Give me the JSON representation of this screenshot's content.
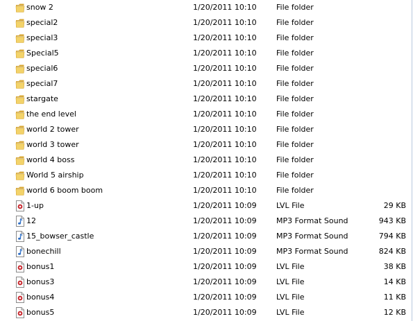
{
  "files": [
    {
      "name": "snow 2",
      "date": "1/20/2011 10:10",
      "type": "File folder",
      "size": "",
      "icon": "folder-icon"
    },
    {
      "name": "special2",
      "date": "1/20/2011 10:10",
      "type": "File folder",
      "size": "",
      "icon": "folder-icon"
    },
    {
      "name": "special3",
      "date": "1/20/2011 10:10",
      "type": "File folder",
      "size": "",
      "icon": "folder-icon"
    },
    {
      "name": "Special5",
      "date": "1/20/2011 10:10",
      "type": "File folder",
      "size": "",
      "icon": "folder-icon"
    },
    {
      "name": "special6",
      "date": "1/20/2011 10:10",
      "type": "File folder",
      "size": "",
      "icon": "folder-icon"
    },
    {
      "name": "special7",
      "date": "1/20/2011 10:10",
      "type": "File folder",
      "size": "",
      "icon": "folder-icon"
    },
    {
      "name": "stargate",
      "date": "1/20/2011 10:10",
      "type": "File folder",
      "size": "",
      "icon": "folder-icon"
    },
    {
      "name": "the end level",
      "date": "1/20/2011 10:10",
      "type": "File folder",
      "size": "",
      "icon": "folder-icon"
    },
    {
      "name": "world 2 tower",
      "date": "1/20/2011 10:10",
      "type": "File folder",
      "size": "",
      "icon": "folder-icon"
    },
    {
      "name": "world 3 tower",
      "date": "1/20/2011 10:10",
      "type": "File folder",
      "size": "",
      "icon": "folder-icon"
    },
    {
      "name": "world 4 boss",
      "date": "1/20/2011 10:10",
      "type": "File folder",
      "size": "",
      "icon": "folder-icon"
    },
    {
      "name": "World 5 airship",
      "date": "1/20/2011 10:10",
      "type": "File folder",
      "size": "",
      "icon": "folder-icon"
    },
    {
      "name": "world 6 boom boom",
      "date": "1/20/2011 10:10",
      "type": "File folder",
      "size": "",
      "icon": "folder-icon"
    },
    {
      "name": "1-up",
      "date": "1/20/2011 10:09",
      "type": "LVL File",
      "size": "29 KB",
      "icon": "lvl-file-icon"
    },
    {
      "name": "12",
      "date": "1/20/2011 10:09",
      "type": "MP3 Format Sound",
      "size": "943 KB",
      "icon": "mp3-file-icon"
    },
    {
      "name": "15_bowser_castle",
      "date": "1/20/2011 10:09",
      "type": "MP3 Format Sound",
      "size": "794 KB",
      "icon": "mp3-file-icon"
    },
    {
      "name": "bonechill",
      "date": "1/20/2011 10:09",
      "type": "MP3 Format Sound",
      "size": "824 KB",
      "icon": "mp3-file-icon"
    },
    {
      "name": "bonus1",
      "date": "1/20/2011 10:09",
      "type": "LVL File",
      "size": "38 KB",
      "icon": "lvl-file-icon"
    },
    {
      "name": "bonus3",
      "date": "1/20/2011 10:09",
      "type": "LVL File",
      "size": "14 KB",
      "icon": "lvl-file-icon"
    },
    {
      "name": "bonus4",
      "date": "1/20/2011 10:09",
      "type": "LVL File",
      "size": "11 KB",
      "icon": "lvl-file-icon"
    },
    {
      "name": "bonus5",
      "date": "1/20/2011 10:09",
      "type": "LVL File",
      "size": "12 KB",
      "icon": "lvl-file-icon"
    }
  ],
  "colors": {
    "folder_main": "#f3d36a",
    "folder_dark": "#d9a93a",
    "lvl_red": "#c8282e",
    "mp3_blue": "#2e6fc7",
    "text": "#000000",
    "frame_border": "#b9c9de"
  }
}
